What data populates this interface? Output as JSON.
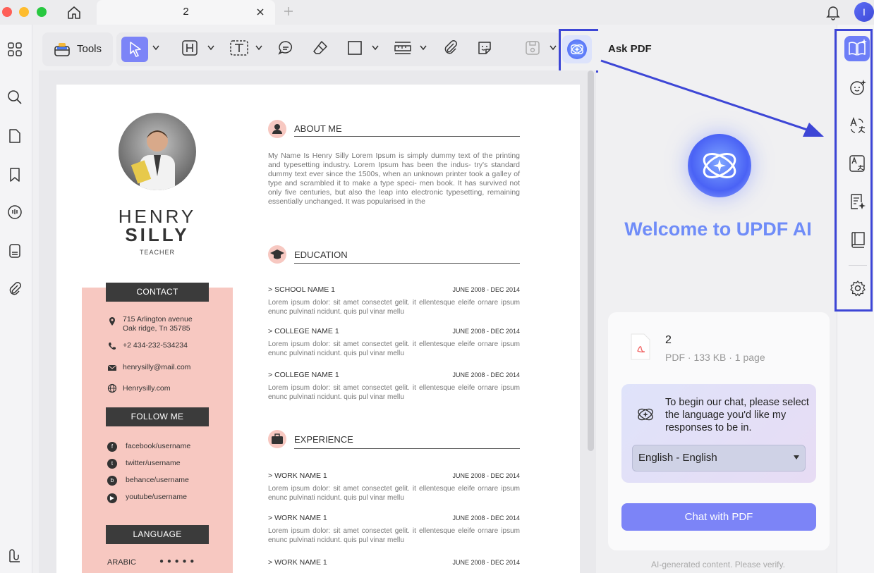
{
  "window": {
    "tab_title": "2",
    "avatar_initial": "I"
  },
  "toolbar": {
    "tools_label": "Tools",
    "ask_pdf_label": "Ask PDF"
  },
  "resume": {
    "first_name": "HENRY",
    "last_name": "SILLY",
    "job_title": "TEACHER",
    "contact_header": "CONTACT",
    "address_line1": "715 Arlington avenue",
    "address_line2": "Oak ridge, Tn 35785",
    "phone": "+2 434-232-534234",
    "email": "henrysilly@mail.com",
    "website": "Henrysilly.com",
    "follow_header": "FOLLOW ME",
    "socials": [
      "facebook/username",
      "twitter/username",
      "behance/username",
      "youtube/username"
    ],
    "language_header": "LANGUAGE",
    "language_1": "ARABIC",
    "language_1_dots": "● ● ● ● ●",
    "about_title": "ABOUT ME",
    "about_text": "My Name Is Henry Silly Lorem Ipsum is simply dummy text of the printing and typesetting industry. Lorem Ipsum has been the indus- try's standard dummy text ever since the 1500s, when an unknown printer took a galley of type and scrambled it to make a type speci- men book. It has survived not only five centuries, but also the leap into electronic typesetting, remaining essentially unchanged. It was popularised in the",
    "education_title": "EDUCATION",
    "experience_title": "EXPERIENCE",
    "lorem": "Lorem ipsum dolor: sit amet consectet gelit. it ellentesque eleife ornare ipsum enunc pulvinati ncidunt. quis pul vinar mellu",
    "education": [
      {
        "name": "SCHOOL NAME 1",
        "date": "JUNE 2008 - DEC 2014"
      },
      {
        "name": "COLLEGE NAME 1",
        "date": "JUNE 2008 - DEC 2014"
      },
      {
        "name": "COLLEGE NAME 1",
        "date": "JUNE 2008 - DEC 2014"
      }
    ],
    "experience": [
      {
        "name": "WORK NAME 1",
        "date": "JUNE 2008 - DEC 2014"
      },
      {
        "name": "WORK NAME 1",
        "date": "JUNE 2008 - DEC 2014"
      },
      {
        "name": "WORK NAME 1",
        "date": "JUNE 2008 - DEC 2014"
      }
    ],
    "bullet": ">"
  },
  "ai": {
    "welcome": "Welcome to UPDF AI",
    "file_name": "2",
    "file_meta": "PDF · 133 KB · 1 page",
    "prompt": "To begin our chat, please select the language you'd like my responses to be in.",
    "language_selected": "English - English",
    "chat_button": "Chat with PDF",
    "disclaimer": "AI-generated content. Please verify."
  },
  "colors": {
    "accent": "#6d7ef7",
    "highlight": "#3d46d6",
    "resume_pink": "#f7c8c1"
  }
}
